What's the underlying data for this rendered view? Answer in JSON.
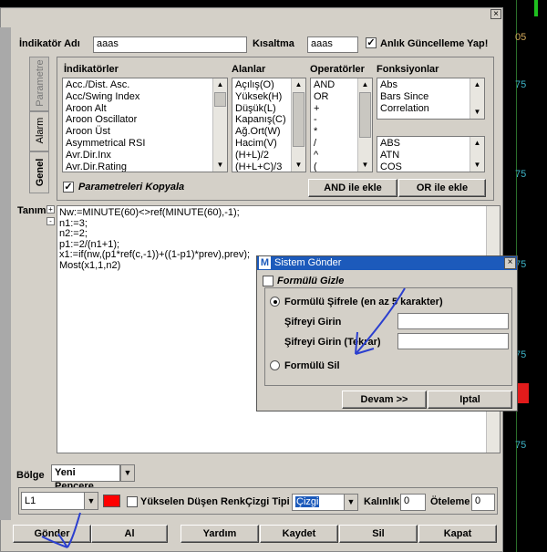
{
  "chart": {
    "labels": [
      "05",
      "75",
      "75",
      "75",
      "75",
      "75"
    ],
    "colors": {
      "number": "#d2a85a",
      "accent": "#e21b1b"
    }
  },
  "form": {
    "name_label": "İndikatör Adı",
    "name_value": "aaas",
    "short_label": "Kısaltma",
    "short_value": "aaas",
    "live_update_label": "Anlık Güncelleme Yap!",
    "live_update_checked": true
  },
  "tabs": [
    "Parametre",
    "Alarm",
    "Genel"
  ],
  "lists": {
    "indicators_header": "İndikatörler",
    "indicators": [
      "Acc./Dist. Asc.",
      "Acc/Swing Index",
      "Aroon Alt",
      "Aroon Oscillator",
      "Aroon Üst",
      "Asymmetrical RSI",
      "Avr.Dir.Inx",
      "Avr.Dir.Rating"
    ],
    "fields_header": "Alanlar",
    "fields": [
      "Açılış(O)",
      "Yüksek(H)",
      "Düşük(L)",
      "Kapanış(C)",
      "Ağ.Ort(W)",
      "Hacim(V)",
      "(H+L)/2",
      "(H+L+C)/3"
    ],
    "operators_header": "Operatörler",
    "operators": [
      "AND",
      "OR",
      "+",
      "-",
      "*",
      "/",
      "^",
      "("
    ],
    "functions_header": "Fonksiyonlar",
    "functions_top": [
      "Abs",
      "Bars Since",
      "Correlation"
    ],
    "functions_bottom": [
      "ABS",
      "ATN",
      "COS"
    ]
  },
  "copy_params_label": "Parametreleri Kopyala",
  "copy_params_checked": true,
  "and_add_label": "AND ile ekle",
  "or_add_label": "OR ile ekle",
  "definition_label": "Tanım",
  "formula_lines": [
    "Nw:=MINUTE(60)<>ref(MINUTE(60),-1);",
    "n1:=3;",
    "n2:=2;",
    "p1:=2/(n1+1);",
    "x1:=if(nw,(p1*ref(c,-1))+((1-p1)*prev),prev);",
    "Most(x1,1,n2)"
  ],
  "region": {
    "label": "Bölge",
    "value": "Yeni Pencere"
  },
  "line": {
    "line_value": "L1",
    "color": "#ff0000",
    "rise_fall_label": "Yükselen Düşen Renk",
    "line_type_label": "Çizgi Tipi",
    "line_type_value": "Çizgi",
    "thickness_label": "Kalınlık",
    "thickness_value": "0",
    "offset_label": "Öteleme",
    "offset_value": "0"
  },
  "buttons": [
    "Gönder",
    "Al",
    "Yardım",
    "Kaydet",
    "Sil",
    "Kapat"
  ],
  "dialog": {
    "title": "Sistem Gönder",
    "title_icon": "M",
    "hide_formula_label": "Formülü Gizle",
    "encrypt_label": "Formülü Şifrele (en az 5 karakter)",
    "password_label": "Şifreyi Girin",
    "password_repeat_label": "Şifreyi Girin (Tekrar)",
    "delete_label": "Formülü Sil",
    "continue_label": "Devam >>",
    "cancel_label": "Iptal"
  }
}
